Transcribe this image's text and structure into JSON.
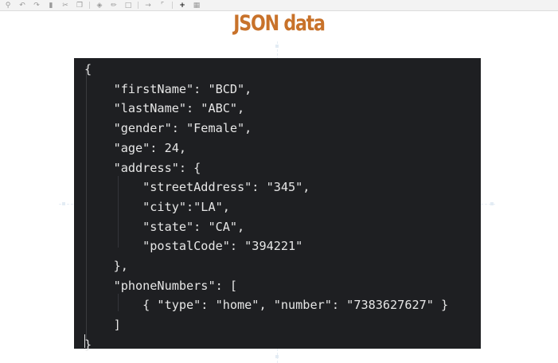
{
  "slide": {
    "title": "JSON data"
  },
  "toolbar": {
    "icons": [
      "zoom-icon",
      "undo-icon",
      "redo-icon",
      "delete-icon",
      "cut-icon",
      "copy-icon",
      "fill-icon",
      "line-icon",
      "shape-icon",
      "connector-icon",
      "waypoint-icon",
      "insert-icon",
      "table-icon"
    ]
  },
  "code": {
    "lines": [
      "{",
      "    \"firstName\": \"BCD\",",
      "    \"lastName\": \"ABC\",",
      "    \"gender\": \"Female\",",
      "    \"age\": 24,",
      "    \"address\": {",
      "        \"streetAddress\": \"345\",",
      "        \"city\":\"LA\",",
      "        \"state\": \"CA\",",
      "        \"postalCode\": \"394221\"",
      "    },",
      "    \"phoneNumbers\": [",
      "        { \"type\": \"home\", \"number\": \"7383627627\" }",
      "    ]",
      "}"
    ]
  },
  "colors": {
    "title": "#c8722a",
    "code_background": "#1e1f22",
    "code_text": "#e6e6e6"
  }
}
